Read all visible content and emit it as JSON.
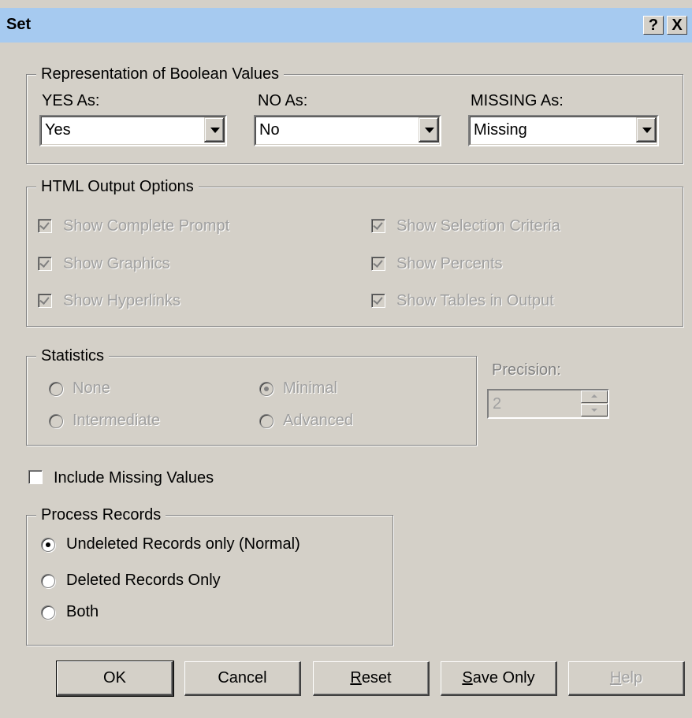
{
  "window": {
    "title": "Set",
    "help_btn": "?",
    "close_btn": "X"
  },
  "boolean_group": {
    "legend": "Representation of Boolean Values",
    "yes_label": "YES As:",
    "yes_value": "Yes",
    "no_label": "NO As:",
    "no_value": "No",
    "missing_label": "MISSING As:",
    "missing_value": "Missing"
  },
  "html_group": {
    "legend": "HTML Output Options",
    "options": [
      {
        "label": "Show Complete Prompt",
        "checked": true,
        "enabled": false
      },
      {
        "label": "Show Selection Criteria",
        "checked": true,
        "enabled": false
      },
      {
        "label": "Show Graphics",
        "checked": true,
        "enabled": false
      },
      {
        "label": "Show Percents",
        "checked": true,
        "enabled": false
      },
      {
        "label": "Show Hyperlinks",
        "checked": true,
        "enabled": false
      },
      {
        "label": "Show Tables in Output",
        "checked": true,
        "enabled": false
      }
    ]
  },
  "statistics_group": {
    "legend": "Statistics",
    "options": [
      "None",
      "Minimal",
      "Intermediate",
      "Advanced"
    ],
    "selected": "Minimal"
  },
  "precision": {
    "label": "Precision:",
    "value": "2"
  },
  "include_missing": {
    "label": "Include Missing Values",
    "checked": false
  },
  "process_group": {
    "legend": "Process Records",
    "options": [
      "Undeleted Records only (Normal)",
      "Deleted Records Only",
      "Both"
    ],
    "selected": "Undeleted Records only (Normal)"
  },
  "buttons": {
    "ok": "OK",
    "cancel": "Cancel",
    "reset_first": "R",
    "reset_rest": "eset",
    "save_first": "S",
    "save_rest": "ave Only",
    "help_first": "H",
    "help_rest": "elp"
  }
}
